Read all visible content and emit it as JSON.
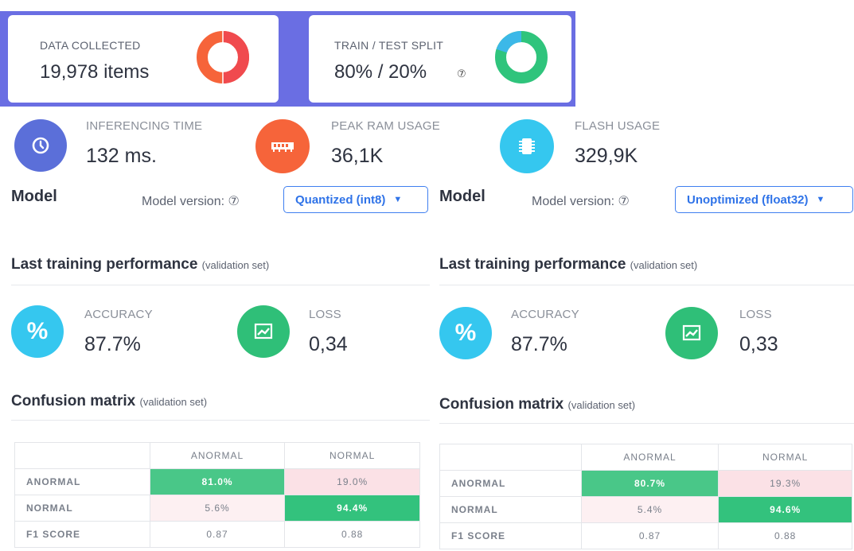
{
  "summary": {
    "data_collected": {
      "label": "DATA COLLECTED",
      "value": "19,978 items"
    },
    "train_test_split": {
      "label": "TRAIN / TEST SPLIT",
      "value": "80% / 20%",
      "train_percent": 80,
      "test_percent": 20
    }
  },
  "colors": {
    "band": "#6a6ee3",
    "blue_circle": "#5b6fd9",
    "orange": "#f6643a",
    "cyan": "#35c7ef",
    "green": "#2fbf78",
    "link_blue": "#2f73e8"
  },
  "metrics": {
    "inferencing_time": {
      "label": "INFERENCING TIME",
      "value": "132 ms.",
      "icon": "clock-icon"
    },
    "peak_ram": {
      "label": "PEAK RAM USAGE",
      "value": "36,1K",
      "icon": "ram-icon"
    },
    "flash": {
      "label": "FLASH USAGE",
      "value": "329,9K",
      "icon": "chip-icon"
    }
  },
  "models": [
    {
      "title": "Model",
      "version_label": "Model version:",
      "version_value": "Quantized (int8)",
      "perf_title": "Last training performance",
      "perf_note": "(validation set)",
      "accuracy_label": "ACCURACY",
      "accuracy_value": "87.7%",
      "loss_label": "LOSS",
      "loss_value": "0,34",
      "cm_title": "Confusion matrix",
      "cm_note": "(validation set)",
      "cm_headers": [
        "ANORMAL",
        "NORMAL"
      ],
      "cm_rows": [
        {
          "label": "ANORMAL",
          "cells": [
            "81.0%",
            "19.0%"
          ]
        },
        {
          "label": "NORMAL",
          "cells": [
            "5.6%",
            "94.4%"
          ]
        },
        {
          "label": "F1 SCORE",
          "cells": [
            "0.87",
            "0.88"
          ]
        }
      ]
    },
    {
      "title": "Model",
      "version_label": "Model version:",
      "version_value": "Unoptimized (float32)",
      "perf_title": "Last training performance",
      "perf_note": "(validation set)",
      "accuracy_label": "ACCURACY",
      "accuracy_value": "87.7%",
      "loss_label": "LOSS",
      "loss_value": "0,33",
      "cm_title": "Confusion matrix",
      "cm_note": "(validation set)",
      "cm_headers": [
        "ANORMAL",
        "NORMAL"
      ],
      "cm_rows": [
        {
          "label": "ANORMAL",
          "cells": [
            "80.7%",
            "19.3%"
          ]
        },
        {
          "label": "NORMAL",
          "cells": [
            "5.4%",
            "94.6%"
          ]
        },
        {
          "label": "F1 SCORE",
          "cells": [
            "0.87",
            "0.88"
          ]
        }
      ]
    }
  ]
}
